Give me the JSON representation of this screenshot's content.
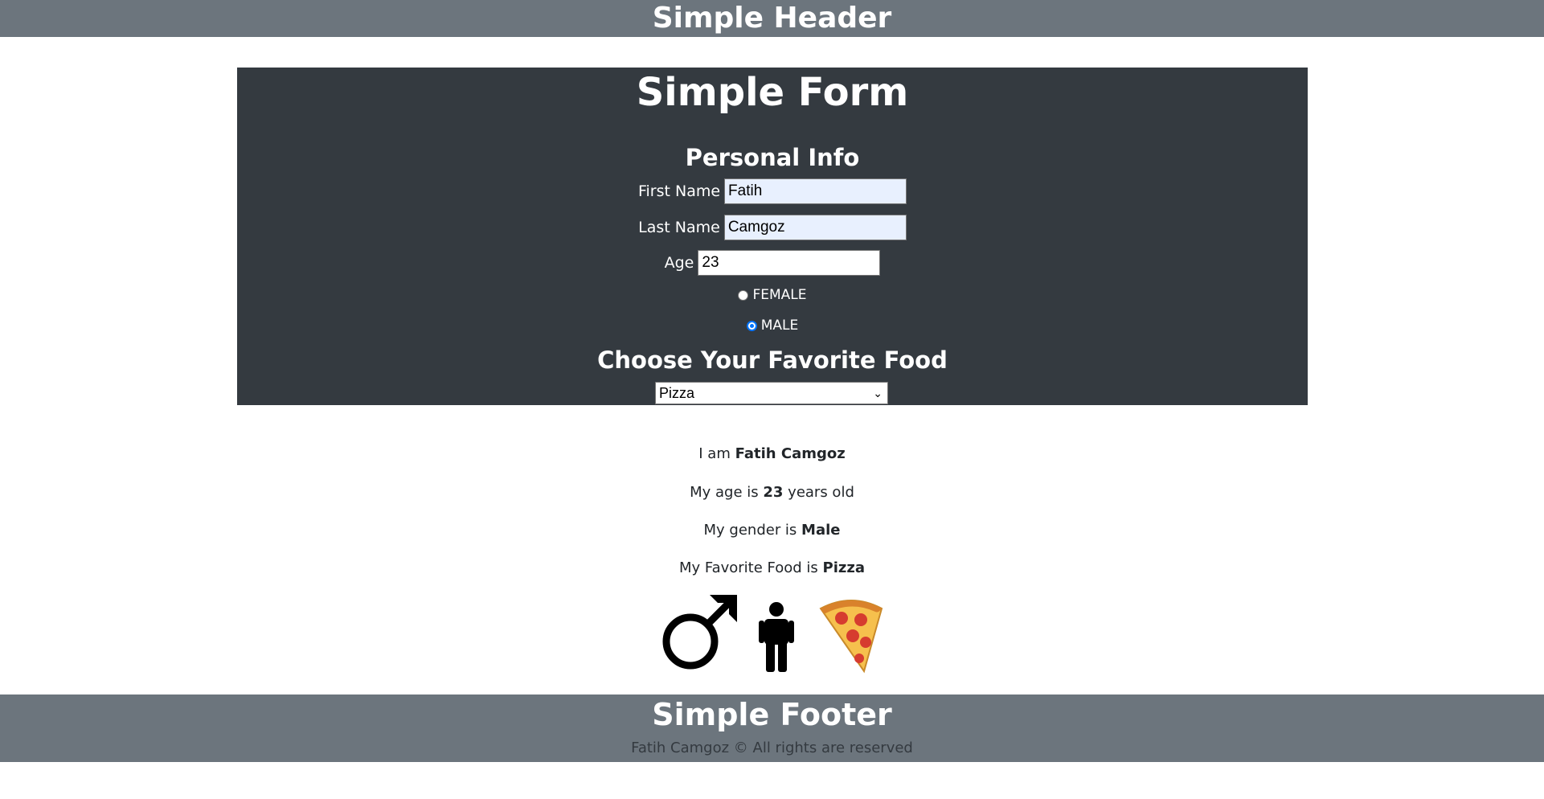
{
  "header": {
    "title": "Simple Header"
  },
  "form": {
    "title": "Simple Form",
    "section_title": "Personal Info",
    "first_name_label": "First Name",
    "first_name_value": "Fatih",
    "last_name_label": "Last Name",
    "last_name_value": "Camgoz",
    "age_label": "Age",
    "age_value": "23",
    "gender_options": [
      {
        "label": "FEMALE",
        "checked": false
      },
      {
        "label": "MALE",
        "checked": true
      }
    ],
    "food_title": "Choose Your Favorite Food",
    "food_selected": "Pizza"
  },
  "summary": {
    "name_prefix": "I am ",
    "name_value": "Fatih Camgoz",
    "age_prefix": "My age is ",
    "age_value": "23",
    "age_suffix": " years old",
    "gender_prefix": "My gender is ",
    "gender_value": "Male",
    "food_prefix": "My Favorite Food is ",
    "food_value": "Pizza"
  },
  "icons": {
    "gender_icon": "male-symbol-icon",
    "person_icon": "man-figure-icon",
    "food_icon": "pizza-icon"
  },
  "footer": {
    "title": "Simple Footer",
    "copyright": "Fatih Camgoz © All rights are reserved"
  },
  "colors": {
    "header_bg": "#6c757d",
    "form_bg": "#343a40",
    "radio_accent": "#0075ff",
    "autofill_bg": "#e8f0fe"
  }
}
